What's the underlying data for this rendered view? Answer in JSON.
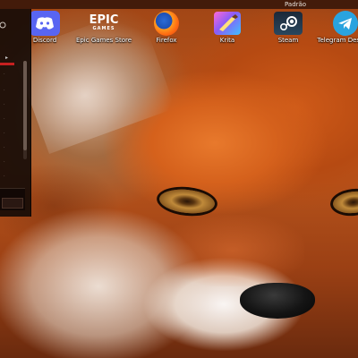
{
  "top_bar": {
    "workspace_label": "Padrão"
  },
  "desktop_icons": [
    {
      "label": "Discord",
      "icon": "discord-icon"
    },
    {
      "label": "Epic Games Store",
      "icon": "epic-games-icon",
      "logo_text": [
        "EPIC",
        "GAMES"
      ]
    },
    {
      "label": "Firefox",
      "icon": "firefox-icon"
    },
    {
      "label": "Krita",
      "icon": "krita-icon"
    },
    {
      "label": "Steam",
      "icon": "steam-icon"
    },
    {
      "label": "Telegram Desktop",
      "icon": "telegram-icon"
    }
  ],
  "side_panel": {
    "header_icon": "power-icon",
    "expanded_arrow": "▸"
  },
  "colors": {
    "accent_red": "#c62020",
    "panel_bg": "#16110c",
    "discord": "#5865f2",
    "telegram": "#2aa3df"
  }
}
